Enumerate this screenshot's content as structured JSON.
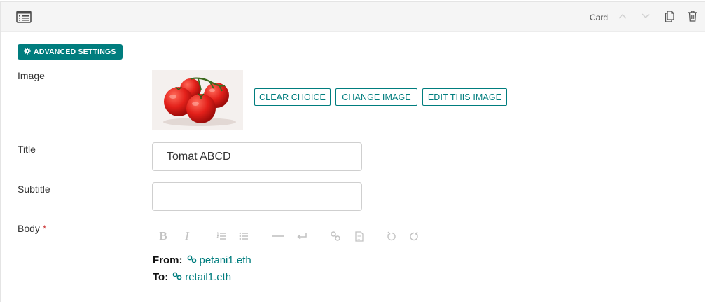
{
  "block": {
    "type_label": "Card",
    "icons": {
      "block": "list-icon",
      "up": "chevron-up-icon",
      "down": "chevron-down-icon",
      "copy": "copy-icon",
      "delete": "trash-icon"
    }
  },
  "advanced": {
    "label": "ADVANCED SETTINGS",
    "icon": "gear-icon"
  },
  "fields": {
    "image": {
      "label": "Image",
      "thumbnail": "tomatoes-image",
      "buttons": [
        "CLEAR CHOICE",
        "CHANGE IMAGE",
        "EDIT THIS IMAGE"
      ]
    },
    "title": {
      "label": "Title",
      "value": "Tomat ABCD"
    },
    "subtitle": {
      "label": "Subtitle",
      "value": ""
    },
    "body": {
      "label": "Body",
      "required_mark": "*",
      "toolbar": [
        "bold-icon",
        "italic-icon",
        "ordered-list-icon",
        "bullet-list-icon",
        "horizontal-rule-icon",
        "line-break-icon",
        "link-icon",
        "document-link-icon",
        "undo-icon",
        "redo-icon"
      ],
      "lines": [
        {
          "key": "From:",
          "link": "petani1.eth"
        },
        {
          "key": "To:",
          "link": "retail1.eth"
        }
      ]
    }
  },
  "colors": {
    "accent": "#007d7e",
    "required": "#cd3c3c",
    "header_bg": "#f5f5f5"
  }
}
